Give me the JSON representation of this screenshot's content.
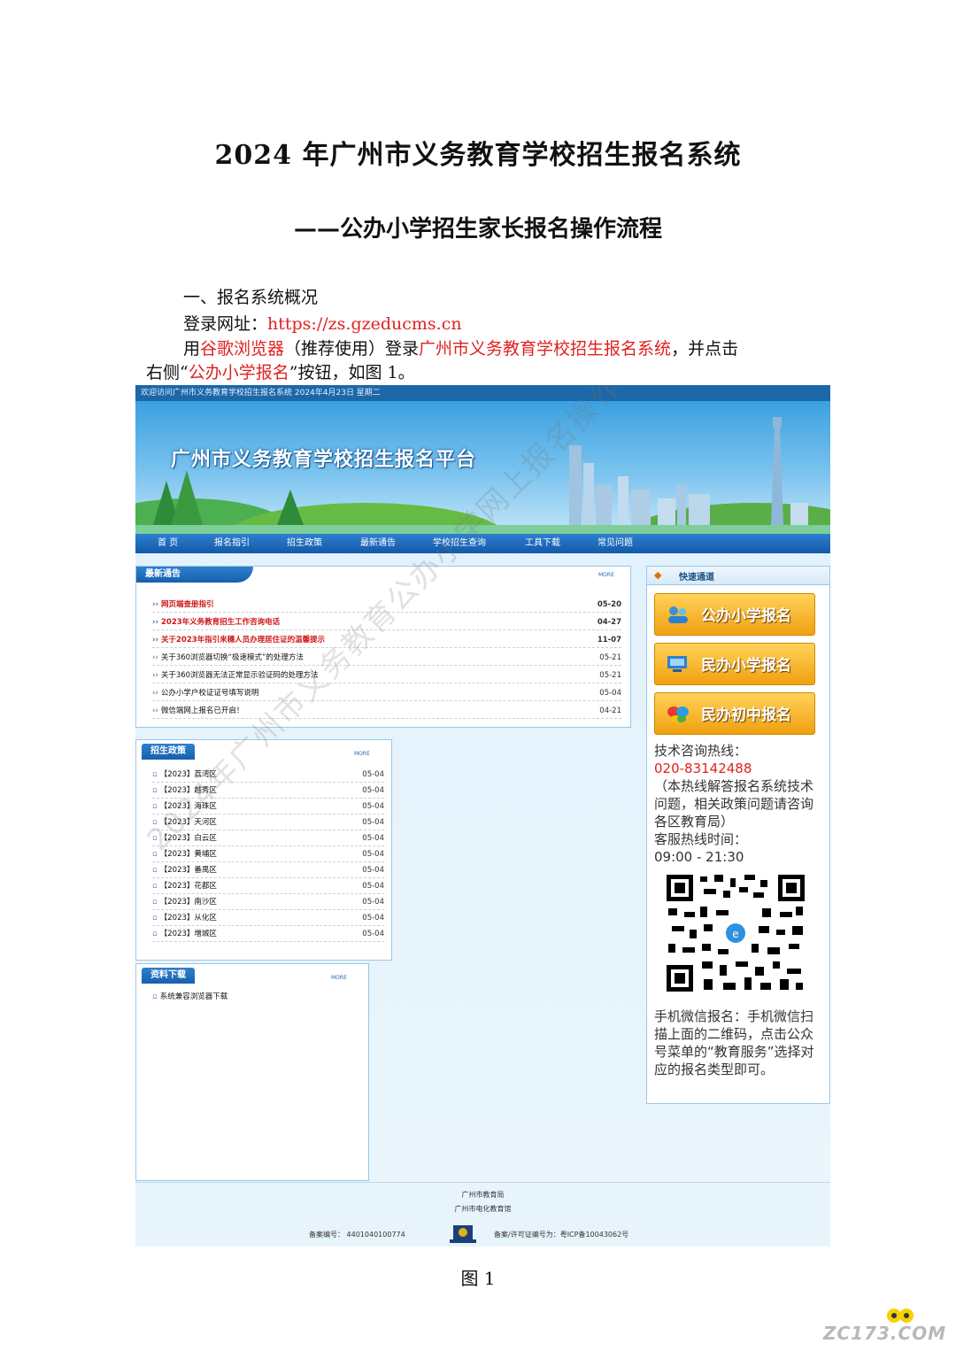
{
  "document": {
    "title": "2024 年广州市义务教育学校招生报名系统",
    "subtitle": "——公办小学招生家长报名操作流程",
    "section_heading": "一、报名系统概况",
    "login_label": "登录网址：",
    "login_url": "https://zs.gzeducms.cn",
    "para_prefix": "用",
    "para_browser": "谷歌浏览器",
    "para_mid": "（推荐使用）登录",
    "para_system": "广州市义务教育学校招生报名系统",
    "para_suffix": "，并点击",
    "para2_prefix": "右侧“",
    "para2_button": "公办小学报名",
    "para2_suffix": "”按钮，如图 1。",
    "figure_caption": "图 1",
    "watermark_site": "ZC173.COM"
  },
  "screenshot": {
    "welcome_bar": "欢迎访问广州市义务教育学校招生报名系统 2024年4月23日 星期二",
    "site_title": "广州市义务教育学校招生报名平台",
    "watermark": "2024年广州市义务教育公办小学网上报名操作指引",
    "nav": [
      "首  页",
      "报名指引",
      "招生政策",
      "最新通告",
      "学校招生查询",
      "工具下载",
      "常见问题"
    ],
    "notices": {
      "title": "最新通告",
      "more": "MORE",
      "items": [
        {
          "text": "网页端查册指引",
          "date": "05-20",
          "highlight": true
        },
        {
          "text": "2023年义务教育招生工作咨询电话",
          "date": "04-27",
          "highlight": true
        },
        {
          "text": "关于2023年指引来穗人员办理居住证的温馨提示",
          "date": "11-07",
          "highlight": true
        },
        {
          "text": "关于360浏览器切换“极速模式”的处理方法",
          "date": "05-21",
          "highlight": false
        },
        {
          "text": "关于360浏览器无法正常显示验证码的处理方法",
          "date": "05-21",
          "highlight": false
        },
        {
          "text": "公办小学户校证证号填写说明",
          "date": "05-04",
          "highlight": false
        },
        {
          "text": "微信端网上报名已开启！",
          "date": "04-21",
          "highlight": false
        }
      ]
    },
    "policy": {
      "title": "招生政策",
      "more": "MORE",
      "items": [
        {
          "text": "【2023】荔湾区",
          "date": "05-04"
        },
        {
          "text": "【2023】越秀区",
          "date": "05-04"
        },
        {
          "text": "【2023】海珠区",
          "date": "05-04"
        },
        {
          "text": "【2023】天河区",
          "date": "05-04"
        },
        {
          "text": "【2023】白云区",
          "date": "05-04"
        },
        {
          "text": "【2023】黄埔区",
          "date": "05-04"
        },
        {
          "text": "【2023】番禺区",
          "date": "05-04"
        },
        {
          "text": "【2023】花都区",
          "date": "05-04"
        },
        {
          "text": "【2023】南沙区",
          "date": "05-04"
        },
        {
          "text": "【2023】从化区",
          "date": "05-04"
        },
        {
          "text": "【2023】增城区",
          "date": "05-04"
        }
      ]
    },
    "downloads": {
      "title": "资料下载",
      "more": "MORE",
      "items": [
        "系统兼容浏览器下载"
      ]
    },
    "quick": {
      "title": "快速通道",
      "buttons": [
        "公办小学报名",
        "民办小学报名",
        "民办初中报名"
      ],
      "hotline_label": "技术咨询热线：",
      "hotline": "020-83142488",
      "hotline_note": "（本热线解答报名系统技术问题，相关政策问题请咨询各区教育局）",
      "hours_label": "客服热线时间：",
      "hours": "09:00 - 21:30",
      "wechat_text": "手机微信报名：手机微信扫描上面的二维码，点击公众号菜单的“教育服务”选择对应的报名类型即可。"
    },
    "footer": {
      "line1": "广州市教育局",
      "line2": "广州市电化教育馆",
      "record": "备案编号： 4401040100774",
      "icp": "备案/许可证编号为：粤ICP备10043062号"
    }
  },
  "colors": {
    "accent_red": "#e02020",
    "nav_blue": "#1c67a8",
    "button_orange": "#f0a010"
  }
}
